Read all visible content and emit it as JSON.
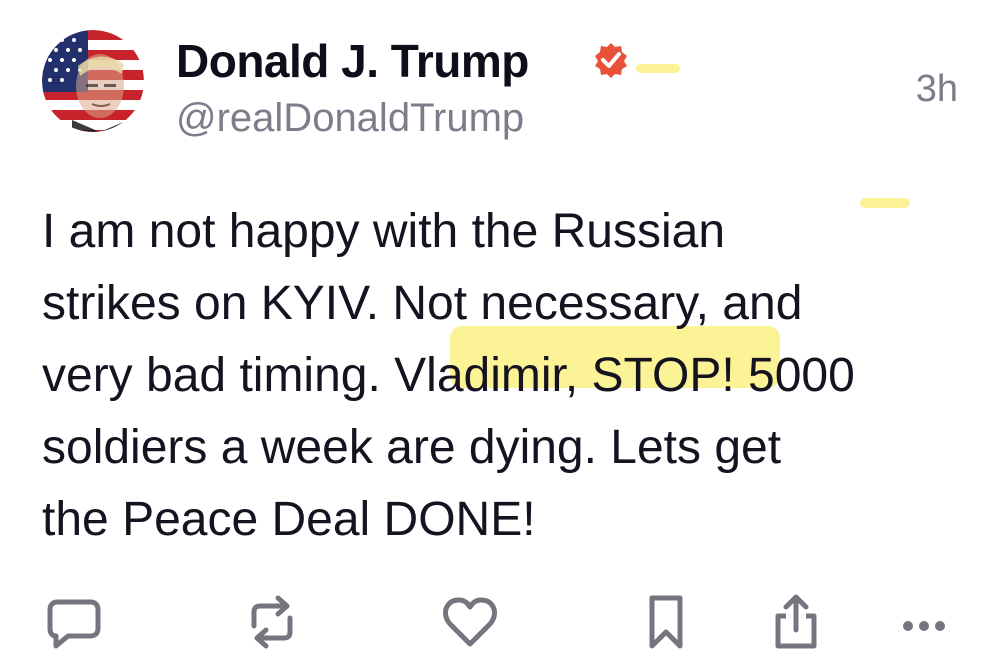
{
  "post": {
    "author": {
      "display_name": "Donald J. Trump",
      "handle": "@realDonaldTrump",
      "verified": true,
      "avatar": "profile-photo-american-flag"
    },
    "timestamp": "3h",
    "text": "I am not happy with the Russian\nstrikes on KYIV. Not necessary, and\nvery bad timing. Vladimir, STOP! 5000\nsoldiers a week are dying. Lets get\nthe Peace Deal DONE!",
    "highlighted_text": "Vladimir, STOP"
  },
  "actions": [
    {
      "name": "reply",
      "icon": "speech-bubble-icon"
    },
    {
      "name": "repost",
      "icon": "repost-arrows-icon"
    },
    {
      "name": "like",
      "icon": "heart-icon"
    },
    {
      "name": "bookmark",
      "icon": "bookmark-icon"
    },
    {
      "name": "share",
      "icon": "share-icon"
    },
    {
      "name": "more",
      "icon": "ellipsis-icon"
    }
  ],
  "colors": {
    "text": "#15131f",
    "muted": "#7e7c8a",
    "verified_badge": "#e8513a",
    "highlight": "#fbf28a",
    "icon": "#76747f"
  }
}
